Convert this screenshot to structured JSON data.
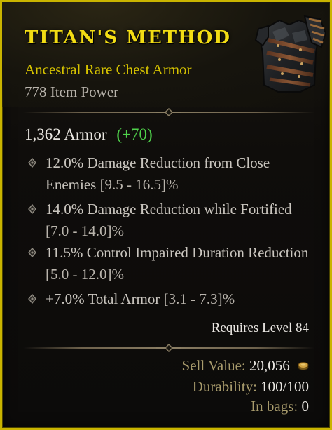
{
  "item": {
    "name": "TITAN'S METHOD",
    "type": "Ancestral Rare Chest Armor",
    "power": "778 Item Power"
  },
  "armor": {
    "value": "1,362 Armor",
    "bonus": "(+70)"
  },
  "affixes": [
    {
      "text": "12.0% Damage Reduction from Close Enemies",
      "range": "[9.5 - 16.5]%"
    },
    {
      "text": "14.0% Damage Reduction while Fortified",
      "range": "[7.0 - 14.0]%"
    },
    {
      "text": "11.5% Control Impaired Duration Reduction",
      "range": "[5.0 - 12.0]%"
    },
    {
      "text": "+7.0% Total Armor",
      "range": "[3.1 - 7.3]%"
    }
  ],
  "requirement": "Requires Level 84",
  "footer": {
    "sell_label": "Sell Value:",
    "sell_value": "20,056",
    "durability_label": "Durability:",
    "durability_value": "100/100",
    "bags_label": "In bags:",
    "bags_value": "0"
  },
  "icons": {
    "bullet": "diamond-bullet-icon",
    "gold": "gold-coin-icon",
    "item_art": "chest-armor-icon"
  },
  "colors": {
    "rare_border": "#c9b400",
    "rare_name": "#f2dc14",
    "bonus_green": "#4fd14b"
  }
}
